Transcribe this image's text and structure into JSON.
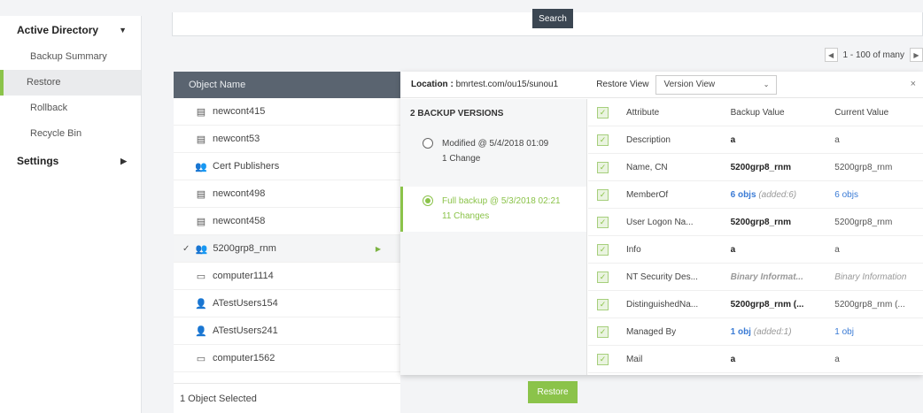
{
  "sidebar": {
    "sections": [
      {
        "label": "Active Directory",
        "chevron": "chevron-down-icon",
        "items": [
          "Backup Summary",
          "Restore",
          "Rollback",
          "Recycle Bin"
        ],
        "active": "Restore"
      },
      {
        "label": "Settings",
        "chevron": "chevron-right-icon"
      }
    ]
  },
  "search": {
    "button_label": "Search"
  },
  "pager": {
    "label": "1 - 100 of many"
  },
  "objects": {
    "header": "Object Name",
    "rows": [
      {
        "name": "newcont415",
        "icon": "container-icon"
      },
      {
        "name": "newcont53",
        "icon": "container-icon"
      },
      {
        "name": "Cert Publishers",
        "icon": "group-icon"
      },
      {
        "name": "newcont498",
        "icon": "container-icon"
      },
      {
        "name": "newcont458",
        "icon": "container-icon"
      },
      {
        "name": "5200grp8_rnm",
        "icon": "group-icon",
        "selected": true
      },
      {
        "name": "computer1114",
        "icon": "computer-icon"
      },
      {
        "name": "ATestUsers154",
        "icon": "user-icon"
      },
      {
        "name": "ATestUsers241",
        "icon": "user-icon"
      },
      {
        "name": "computer1562",
        "icon": "computer-icon"
      }
    ],
    "footer": "1 Object Selected"
  },
  "restore_button": "Restore",
  "detail": {
    "location_label": "Location :",
    "location_value": "bmrtest.com/ou15/sunou1",
    "restore_view_label": "Restore View",
    "restore_view_value": "Version View",
    "close_glyph": "×",
    "versions_title": "2 BACKUP VERSIONS",
    "versions": [
      {
        "title": "Modified @ 5/4/2018 01:09",
        "sub": "1 Change",
        "selected": false
      },
      {
        "title": "Full backup @ 5/3/2018 02:21",
        "sub": "11 Changes",
        "selected": true
      }
    ],
    "attr_header": {
      "attribute": "Attribute",
      "backup": "Backup Value",
      "current": "Current Value"
    },
    "attributes": [
      {
        "attribute": "Description",
        "backup": "a",
        "current": "a"
      },
      {
        "attribute": "Name, CN",
        "backup": "5200grp8_rnm",
        "current": "5200grp8_rnm"
      },
      {
        "attribute": "MemberOf",
        "backup": "6 objs",
        "backup_note": "(added:6)",
        "current": "6 objs"
      },
      {
        "attribute": "User Logon Na...",
        "backup": "5200grp8_rnm",
        "current": "5200grp8_rnm"
      },
      {
        "attribute": "Info",
        "backup": "a",
        "current": "a"
      },
      {
        "attribute": "NT Security Des...",
        "backup": "Binary Informat...",
        "current": "Binary Information"
      },
      {
        "attribute": "DistinguishedNa...",
        "backup": "5200grp8_rnm (...",
        "current": "5200grp8_rnm (..."
      },
      {
        "attribute": "Managed By",
        "backup": "1 obj",
        "backup_note": "(added:1)",
        "current": "1 obj"
      },
      {
        "attribute": "Mail",
        "backup": "a",
        "current": "a"
      }
    ]
  },
  "colors": {
    "accent": "#8bc34a",
    "header": "#5a6470",
    "link": "#3a7bd5"
  }
}
